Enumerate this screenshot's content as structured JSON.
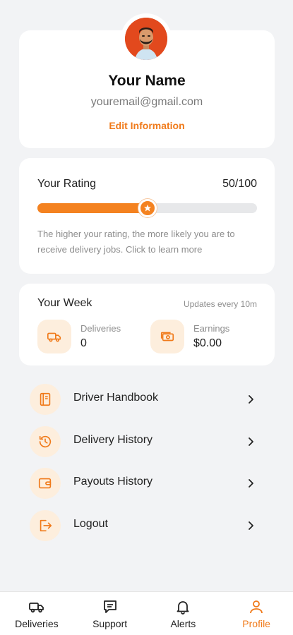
{
  "profile": {
    "name": "Your Name",
    "email": "youremail@gmail.com",
    "edit_label": "Edit Information",
    "avatar_icon": "avatar-illustration"
  },
  "rating": {
    "title": "Your Rating",
    "value_text": "50/100",
    "progress_fraction": 0.5,
    "note": "The higher your rating, the more likely you are to receive delivery jobs. Click to learn more"
  },
  "week": {
    "title": "Your Week",
    "updates": "Updates every 10m",
    "deliveries_label": "Deliveries",
    "deliveries_value": "0",
    "earnings_label": "Earnings",
    "earnings_value": "$0.00"
  },
  "menu": [
    {
      "label": "Driver Handbook",
      "icon": "book-icon"
    },
    {
      "label": "Delivery History",
      "icon": "history-icon"
    },
    {
      "label": "Payouts History",
      "icon": "wallet-icon"
    },
    {
      "label": "Logout",
      "icon": "logout-icon"
    }
  ],
  "nav": [
    {
      "label": "Deliveries",
      "icon": "truck-icon",
      "active": false
    },
    {
      "label": "Support",
      "icon": "chat-icon",
      "active": false
    },
    {
      "label": "Alerts",
      "icon": "bell-icon",
      "active": false
    },
    {
      "label": "Profile",
      "icon": "person-icon",
      "active": true
    }
  ],
  "colors": {
    "accent": "#f48220",
    "accent_light": "#fdeedd",
    "background": "#f2f3f5",
    "card": "#ffffff"
  }
}
